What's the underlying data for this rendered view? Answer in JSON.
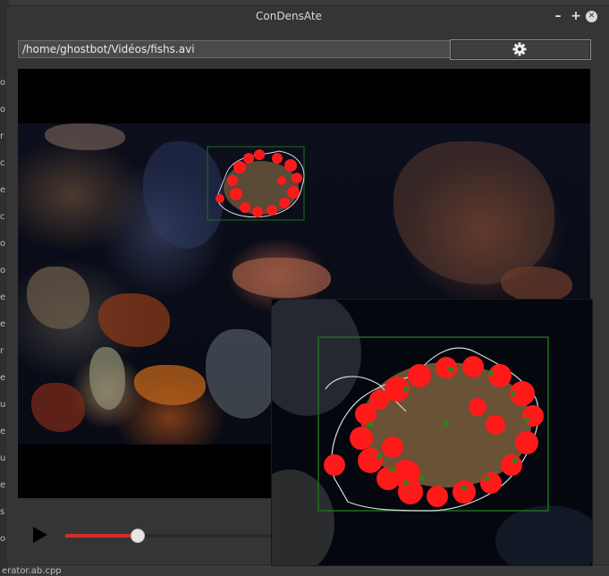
{
  "window": {
    "title": "ConDensAte",
    "minimize_label": "–",
    "maximize_label": "+",
    "close_label": "✕"
  },
  "toolbar": {
    "file_path": "/home/ghostbot/Vidéos/fishs.avi",
    "settings_icon": "gear-icon"
  },
  "playback": {
    "progress": 0.27,
    "play_icon": "play-icon"
  },
  "background_window": {
    "side_letters": [
      "o",
      "o",
      "r",
      "c",
      "e",
      "c",
      "o",
      "o",
      "e",
      "e",
      "r",
      "e",
      "u",
      "e",
      "u",
      "e",
      "s",
      "o"
    ],
    "bottom_text": "erator.ab.cpp"
  },
  "colors": {
    "detection_box": "#1e6e1e",
    "blob": "#ff1a1a",
    "contour": "#d9d9d9",
    "feature_point": "#1e8a1e",
    "seek_fill": "#d42b2b"
  }
}
